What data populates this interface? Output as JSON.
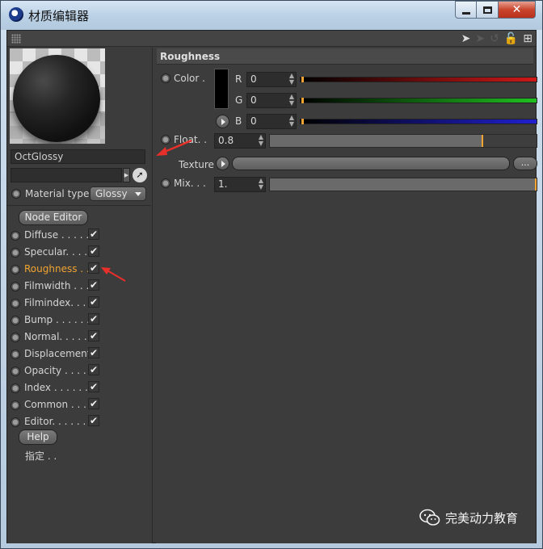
{
  "window": {
    "title": "材质编辑器"
  },
  "toolbar": {
    "icons": [
      "back-arrow-icon",
      "forward-arrow-icon",
      "history-icon",
      "lock-icon",
      "new-panel-icon"
    ]
  },
  "material": {
    "name": "OctGlossy",
    "material_type_label": "Material type",
    "material_type_value": "Glossy",
    "node_editor_label": "Node Editor",
    "help_label": "Help",
    "assign_label": "指定 . ."
  },
  "channels": [
    {
      "label": "Diffuse . . . . . .",
      "checked": "✔",
      "active": false
    },
    {
      "label": "Specular. . . . .",
      "checked": "✔",
      "active": false
    },
    {
      "label": "Roughness . .",
      "checked": "✔",
      "active": true
    },
    {
      "label": "Filmwidth . . .",
      "checked": "✔",
      "active": false
    },
    {
      "label": "Filmindex. . . .",
      "checked": "✔",
      "active": false
    },
    {
      "label": "Bump . . . . . . .",
      "checked": "✔",
      "active": false
    },
    {
      "label": "Normal. . . . . .",
      "checked": "✔",
      "active": false
    },
    {
      "label": "Displacement",
      "checked": "✔",
      "active": false
    },
    {
      "label": "Opacity . . . . .",
      "checked": "✔",
      "active": false
    },
    {
      "label": "Index . . . . . . .",
      "checked": "✔",
      "active": false
    },
    {
      "label": "Common . . . .",
      "checked": "✔",
      "active": false
    },
    {
      "label": "Editor. . . . . . .",
      "checked": "✔",
      "active": false
    }
  ],
  "roughness": {
    "header": "Roughness",
    "color_label": "Color .",
    "r_label": "R",
    "r_value": "0",
    "g_label": "G",
    "g_value": "0",
    "b_label": "B",
    "b_value": "0",
    "float_label": "Float. .",
    "float_value": "0.8",
    "float_level": 0.8,
    "texture_label": "Texture",
    "texture_browse": "...",
    "mix_label": "Mix. . .",
    "mix_value": "1.",
    "mix_level": 1.0
  },
  "colors": {
    "accent": "#f1a431",
    "annotation_arrow": "#e8302a",
    "r_slider": "#d01818",
    "g_slider": "#20c020",
    "b_slider": "#2020d0"
  },
  "watermark": {
    "text": "完美动力教育"
  }
}
